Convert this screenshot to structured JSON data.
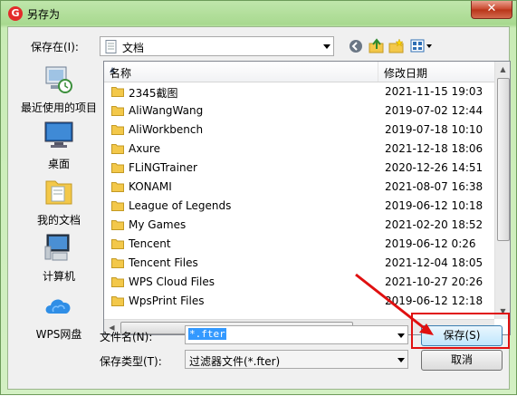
{
  "window": {
    "title": "另存为",
    "close_label": "✕",
    "app_icon_glyph": "G"
  },
  "location": {
    "label": "保存在(I):",
    "value": "文档"
  },
  "places": [
    {
      "label": "最近使用的项目",
      "icon": "recent-items-icon"
    },
    {
      "label": "桌面",
      "icon": "desktop-icon"
    },
    {
      "label": "我的文档",
      "icon": "my-documents-icon"
    },
    {
      "label": "计算机",
      "icon": "computer-icon"
    },
    {
      "label": "WPS网盘",
      "icon": "wps-cloud-icon"
    }
  ],
  "list": {
    "columns": [
      "名称",
      "修改日期"
    ],
    "rows": [
      {
        "name": "2345截图",
        "date": "2021-11-15 19:03"
      },
      {
        "name": "AliWangWang",
        "date": "2019-07-02 12:44"
      },
      {
        "name": "AliWorkbench",
        "date": "2019-07-18 10:10"
      },
      {
        "name": "Axure",
        "date": "2021-12-18 18:06"
      },
      {
        "name": "FLiNGTrainer",
        "date": "2020-12-26 14:51"
      },
      {
        "name": "KONAMI",
        "date": "2021-08-07 16:38"
      },
      {
        "name": "League of Legends",
        "date": "2019-06-12 10:18"
      },
      {
        "name": "My Games",
        "date": "2021-02-20 18:52"
      },
      {
        "name": "Tencent",
        "date": "2019-06-12 0:26"
      },
      {
        "name": "Tencent Files",
        "date": "2021-12-04 18:05"
      },
      {
        "name": "WPS Cloud Files",
        "date": "2021-10-27 20:26"
      },
      {
        "name": "WpsPrint Files",
        "date": "2019-06-12 12:18"
      }
    ]
  },
  "filename": {
    "label": "文件名(N):",
    "value": "*.fter"
  },
  "filetype": {
    "label": "保存类型(T):",
    "value": "过滤器文件(*.fter)"
  },
  "buttons": {
    "save": "保存(S)",
    "cancel": "取消"
  },
  "colors": {
    "annotation": "#e01010",
    "folder": "#f3c84a"
  }
}
